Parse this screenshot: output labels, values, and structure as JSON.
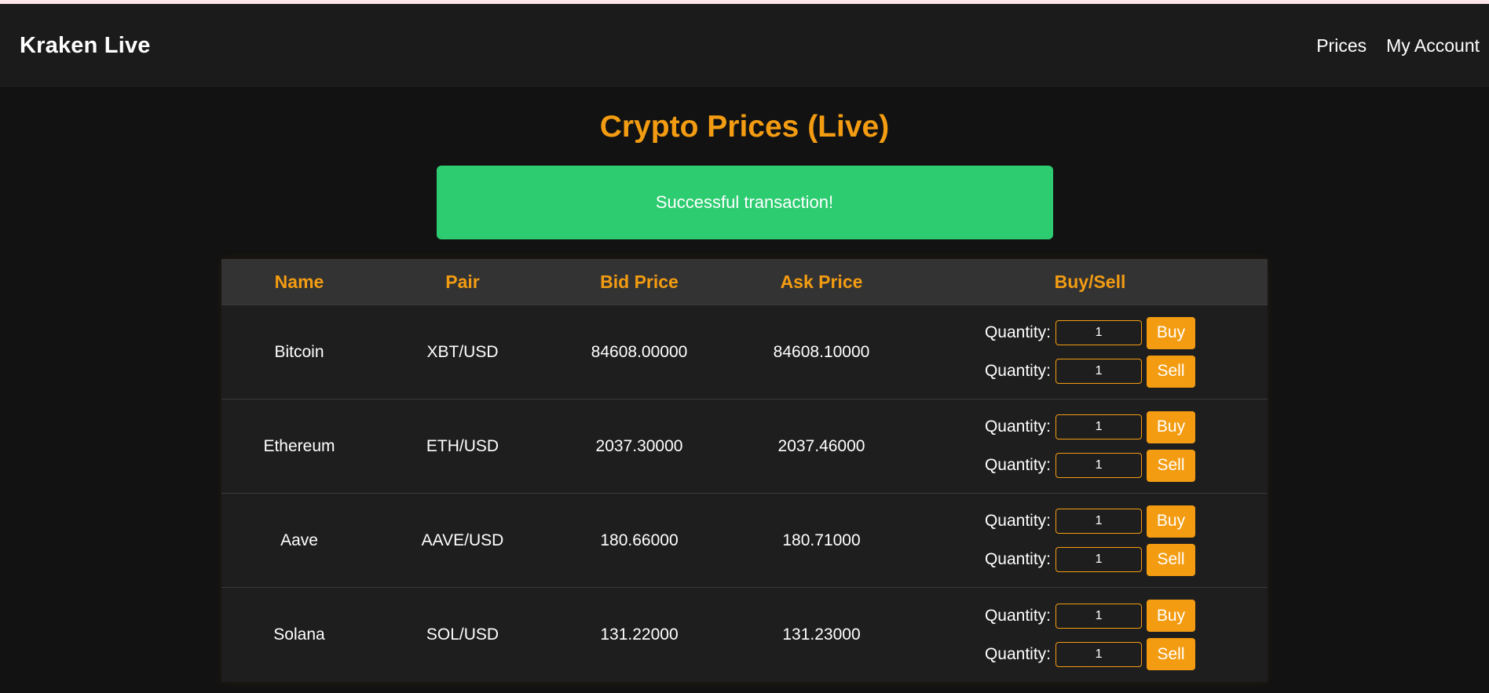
{
  "nav": {
    "brand": "Kraken Live",
    "links": [
      {
        "label": "Prices"
      },
      {
        "label": "My Account"
      }
    ]
  },
  "page": {
    "title": "Crypto Prices (Live)"
  },
  "alert": {
    "message": "Successful transaction!"
  },
  "table": {
    "headers": {
      "name": "Name",
      "pair": "Pair",
      "bid": "Bid Price",
      "ask": "Ask Price",
      "trade": "Buy/Sell"
    },
    "quantity_label": "Quantity:",
    "buy_label": "Buy",
    "sell_label": "Sell",
    "rows": [
      {
        "name": "Bitcoin",
        "pair": "XBT/USD",
        "bid": "84608.00000",
        "ask": "84608.10000",
        "buy_qty": "1",
        "sell_qty": "1"
      },
      {
        "name": "Ethereum",
        "pair": "ETH/USD",
        "bid": "2037.30000",
        "ask": "2037.46000",
        "buy_qty": "1",
        "sell_qty": "1"
      },
      {
        "name": "Aave",
        "pair": "AAVE/USD",
        "bid": "180.66000",
        "ask": "180.71000",
        "buy_qty": "1",
        "sell_qty": "1"
      },
      {
        "name": "Solana",
        "pair": "SOL/USD",
        "bid": "131.22000",
        "ask": "131.23000",
        "buy_qty": "1",
        "sell_qty": "1"
      }
    ]
  },
  "colors": {
    "accent": "#f39c12",
    "success": "#2ecc71",
    "background": "#121212",
    "navbar": "#1b1b1b",
    "table_header": "#333333",
    "table_body": "#1e1e1e"
  }
}
